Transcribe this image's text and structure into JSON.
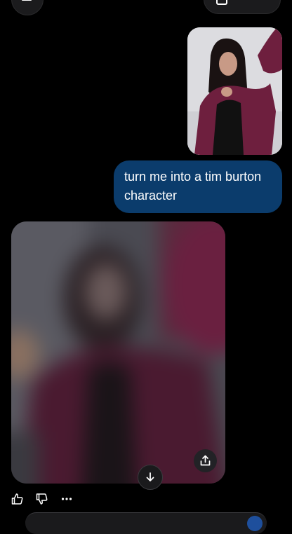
{
  "top_bar": {
    "menu_icon": "menu-icon",
    "new_chat_icon": "compose-icon"
  },
  "conversation": {
    "user_message": {
      "attachment_icon": "photo-attachment",
      "text": "turn me into a tim burton character"
    },
    "assistant_message": {
      "image_state": "generating",
      "share_icon": "share-icon"
    }
  },
  "message_actions": {
    "like_icon": "thumbs-up-icon",
    "dislike_icon": "thumbs-down-icon",
    "more_icon": "more-icon"
  },
  "scroll_down_icon": "arrow-down-icon",
  "colors": {
    "background": "#000000",
    "user_bubble": "#0b3c6c",
    "accent": "#1e4f9c"
  }
}
